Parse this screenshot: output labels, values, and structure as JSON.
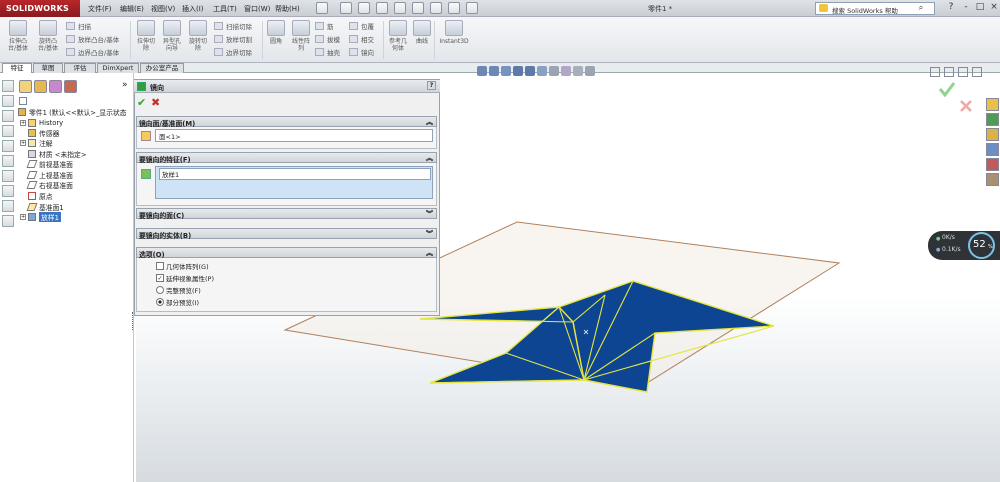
{
  "app": {
    "logo_text": "SOLIDWORKS",
    "doc_title": "零件1 *",
    "search_placeholder": "搜索 SolidWorks 帮助",
    "menu": [
      "文件(F)",
      "编辑(E)",
      "视图(V)",
      "插入(I)",
      "工具(T)",
      "窗口(W)",
      "帮助(H)"
    ],
    "window_controls": [
      "?",
      "-",
      "□",
      "×"
    ]
  },
  "ribbon": {
    "big_buttons": [
      {
        "label": "拉伸凸\n台/基体"
      },
      {
        "label": "旋转凸\n台/基体"
      },
      {
        "label": "拉伸切\n除"
      },
      {
        "label": "异型孔\n向导"
      },
      {
        "label": "旋转切\n除"
      },
      {
        "label": "圆角"
      },
      {
        "label": "线性阵\n列"
      },
      {
        "label": "参考几\n何体"
      },
      {
        "label": "曲线"
      },
      {
        "label": "Instant3D"
      }
    ],
    "small_buttons": [
      "扫描",
      "放样凸台/基体",
      "边界凸台/基体",
      "扫描切除",
      "放样切割",
      "边界切除",
      "筋",
      "拔模",
      "抽壳",
      "包覆",
      "相交",
      "镜向"
    ]
  },
  "tabs": [
    "特征",
    "草图",
    "评估",
    "DimXpert",
    "办公室产品"
  ],
  "feature_tree": {
    "root": "零件1 (默认<<默认>_显示状态",
    "items": [
      "History",
      "传感器",
      "注解",
      "材质 <未指定>",
      "前视基准面",
      "上视基准面",
      "右视基准面",
      "原点",
      "基准面1",
      "放样1"
    ]
  },
  "property_manager": {
    "title": "镜向",
    "help_icon": "?",
    "sections": {
      "mirror_face": {
        "header": "镜向面/基准面(M)",
        "value": "面<1>"
      },
      "features": {
        "header": "要镜向的特征(F)",
        "value": "放样1"
      },
      "faces": {
        "header": "要镜向的面(C)"
      },
      "bodies": {
        "header": "要镜向的实体(B)"
      },
      "options": {
        "header": "选项(O)",
        "items": [
          {
            "label": "几何体阵列(G)",
            "type": "checkbox",
            "checked": false
          },
          {
            "label": "延伸视象属性(P)",
            "type": "checkbox",
            "checked": true
          },
          {
            "label": "完整预览(F)",
            "type": "radio",
            "checked": false
          },
          {
            "label": "部分预览(I)",
            "type": "radio",
            "checked": true
          }
        ]
      }
    }
  },
  "gauge": {
    "percent": "52",
    "percent_sign": "%",
    "up": "0K/s",
    "down": "0.1K/s"
  },
  "colors": {
    "star_fill": "#0d4592",
    "star_edge": "#e5e542",
    "plane_edge": "#b0805c",
    "confirm": "#2ea52e",
    "cancel": "#c8302a"
  }
}
